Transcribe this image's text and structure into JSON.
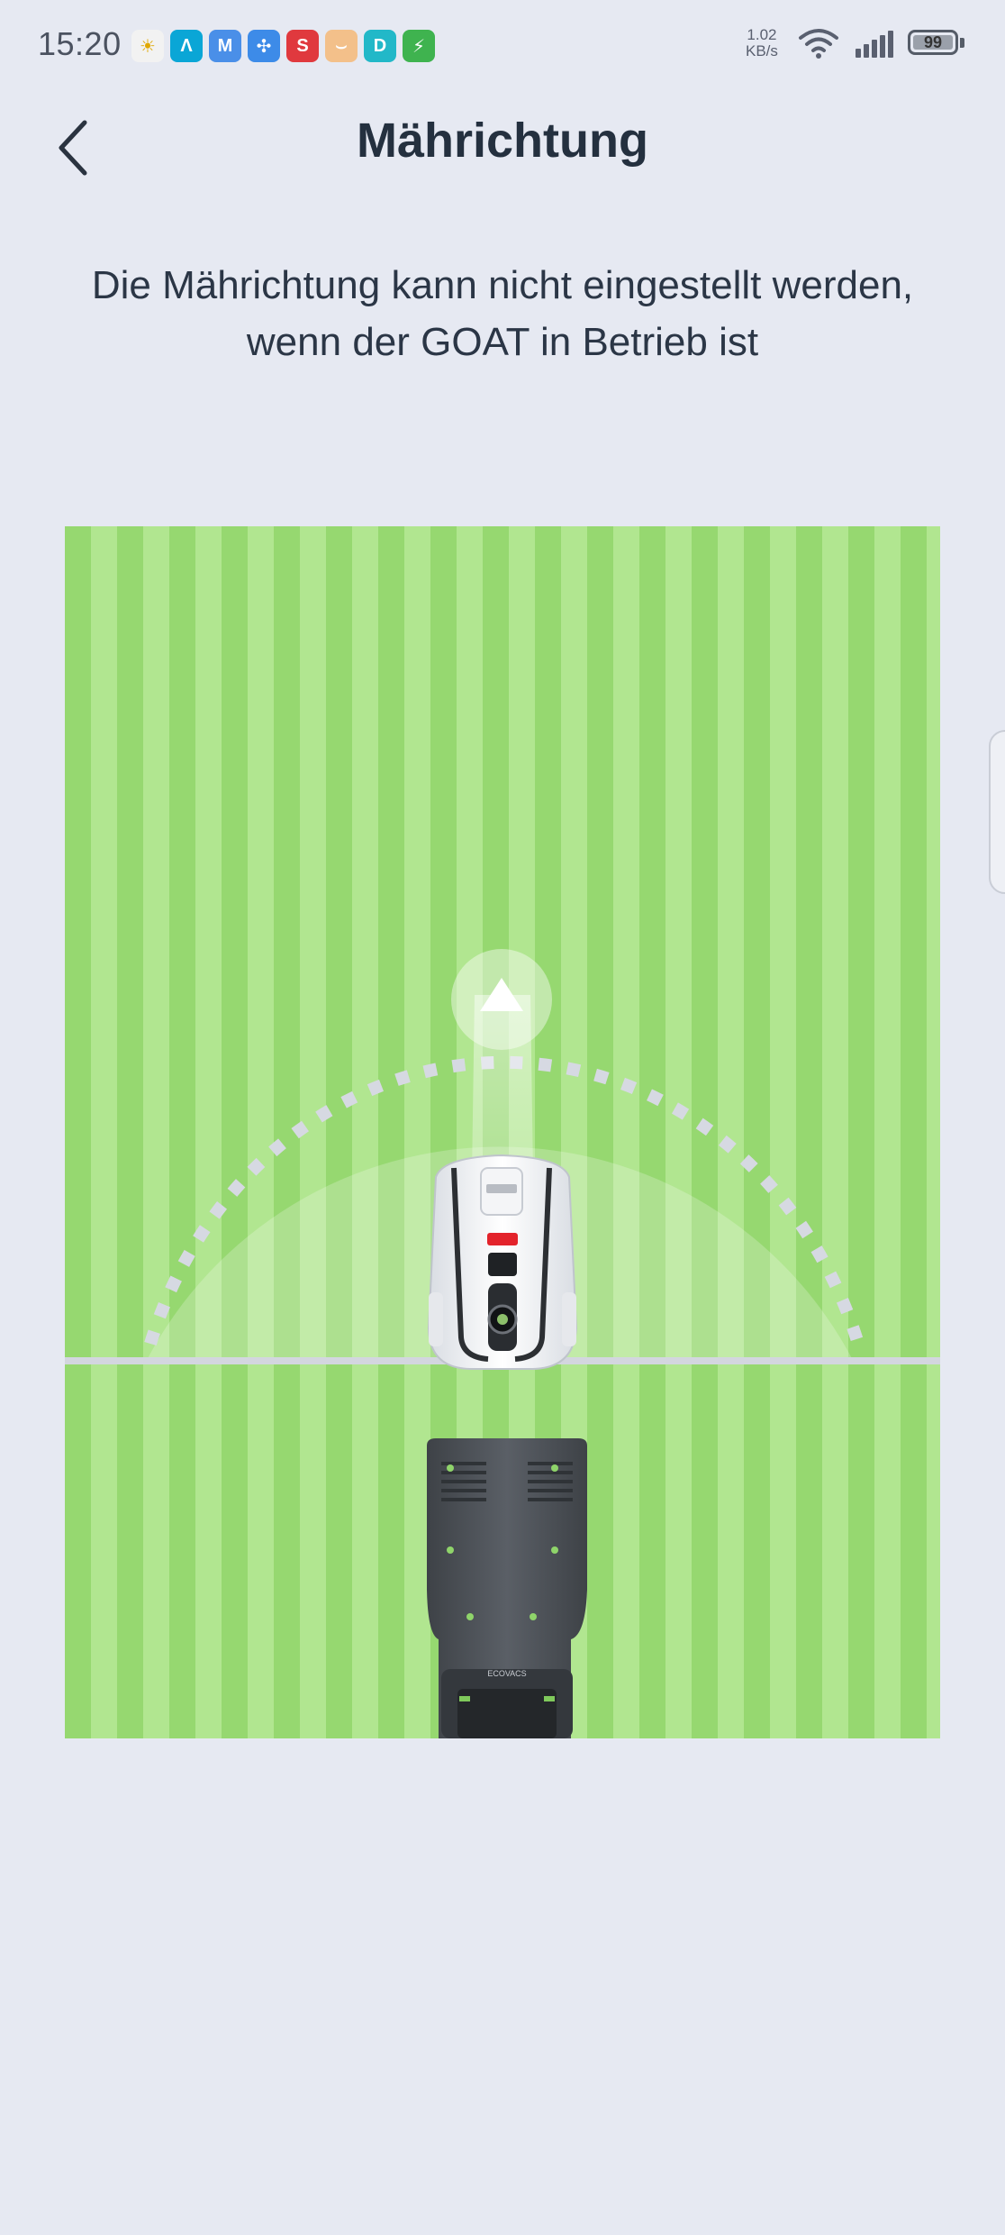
{
  "status_bar": {
    "time": "15:20",
    "net_speed_value": "1.02",
    "net_speed_unit": "KB/s",
    "battery_level": "99",
    "app_icons": [
      {
        "name": "weather-app-icon",
        "color": "#f2f2f2",
        "glyph": "☀"
      },
      {
        "name": "arc-app-icon",
        "color": "#0aa6d6",
        "glyph": "Λ"
      },
      {
        "name": "mail-app-icon",
        "color": "#4a8fe8",
        "glyph": "M"
      },
      {
        "name": "fan-app-icon",
        "color": "#3d8be8",
        "glyph": "✣"
      },
      {
        "name": "s-app-icon",
        "color": "#e0393e",
        "glyph": "S"
      },
      {
        "name": "amazon-app-icon",
        "color": "#f3c08a",
        "glyph": "⌣"
      },
      {
        "name": "d-app-icon",
        "color": "#22b8c8",
        "glyph": "D"
      },
      {
        "name": "battery-app-icon",
        "color": "#3fb34f",
        "glyph": "⚡"
      }
    ]
  },
  "header": {
    "title": "Mährichtung",
    "back_icon": "chevron-left-icon"
  },
  "info": {
    "message": "Die Mährichtung kann nicht eingestellt werden, wenn der GOAT in Betrieb ist"
  },
  "illustration": {
    "stripe_colors": [
      "#96d870",
      "#b1e690"
    ],
    "direction_icon": "arrow-up-icon",
    "mower_label": "GOAT",
    "dock_label": "ECOVACS"
  }
}
